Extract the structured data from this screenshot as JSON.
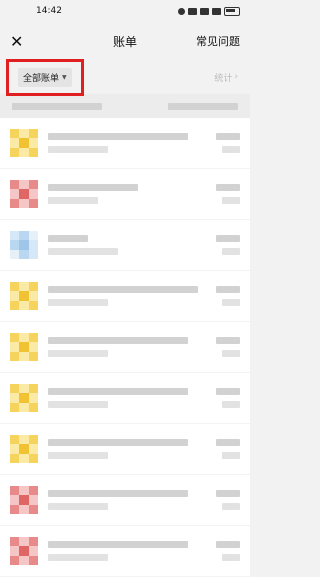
{
  "status_bar": {
    "time": "14:42"
  },
  "nav": {
    "title": "账单",
    "right_link": "常见问题",
    "close_glyph": "✕"
  },
  "filter": {
    "label": "全部账单",
    "caret": "▼",
    "stats_label": "统计",
    "stats_arrow": "›"
  },
  "colors": {
    "highlight": "#e02020",
    "yellow": "#f1c232",
    "red": "#e06666",
    "blue": "#9fc5e8"
  },
  "transactions": [
    {
      "icon": "yellow",
      "title_w": 140,
      "sub_w": 60
    },
    {
      "icon": "red",
      "title_w": 90,
      "sub_w": 50
    },
    {
      "icon": "blue",
      "title_w": 40,
      "sub_w": 70
    },
    {
      "icon": "yellow",
      "title_w": 150,
      "sub_w": 60
    },
    {
      "icon": "yellow",
      "title_w": 140,
      "sub_w": 60
    },
    {
      "icon": "yellow",
      "title_w": 140,
      "sub_w": 60
    },
    {
      "icon": "yellow",
      "title_w": 140,
      "sub_w": 60
    },
    {
      "icon": "red",
      "title_w": 140,
      "sub_w": 60
    },
    {
      "icon": "red",
      "title_w": 140,
      "sub_w": 60
    }
  ]
}
